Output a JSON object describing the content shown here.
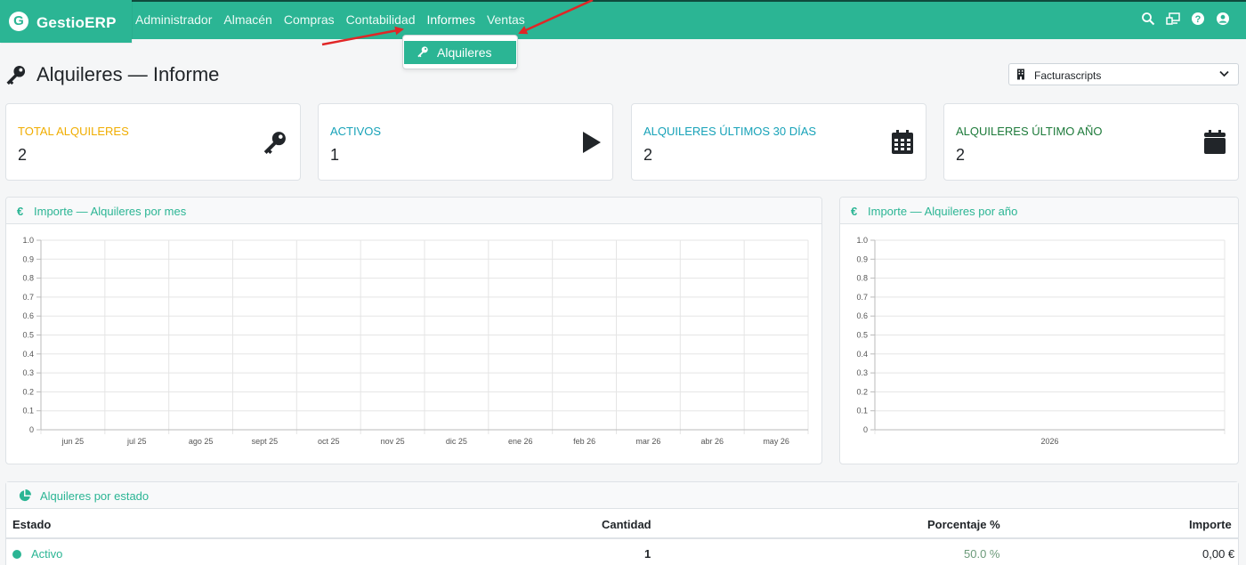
{
  "brand": {
    "logo_letter": "G",
    "name": "GestioERP"
  },
  "nav": {
    "items": [
      {
        "label": "Administrador",
        "active": false
      },
      {
        "label": "Almacén",
        "active": false
      },
      {
        "label": "Compras",
        "active": false
      },
      {
        "label": "Contabilidad",
        "active": false
      },
      {
        "label": "Informes",
        "active": true
      },
      {
        "label": "Ventas",
        "active": false
      }
    ],
    "icons": [
      "search-icon",
      "screen-share-icon",
      "help-icon",
      "user-icon"
    ]
  },
  "dropdown": {
    "item_label": "Alquileres",
    "item_icon": "key-icon"
  },
  "page": {
    "title": "Alquileres — Informe",
    "title_icon": "key-icon"
  },
  "company_select": {
    "value": "Facturascripts",
    "icon": "building-icon"
  },
  "stats": [
    {
      "label": "TOTAL ALQUILERES",
      "value": "2",
      "color": "#f0ad00",
      "icon": "key-icon"
    },
    {
      "label": "ACTIVOS",
      "value": "1",
      "color": "#17a2b8",
      "icon": "play-icon"
    },
    {
      "label": "ALQUILERES ÚLTIMOS 30 DÍAS",
      "value": "2",
      "color": "#17a2b8",
      "icon": "calendar-grid-icon"
    },
    {
      "label": "ALQUILERES ÚLTIMO AÑO",
      "value": "2",
      "color": "#1d7a3a",
      "icon": "calendar-icon"
    }
  ],
  "monthly_panel": {
    "icon": "€",
    "title": "Importe — Alquileres por mes"
  },
  "yearly_panel": {
    "icon": "€",
    "title": "Importe — Alquileres por año"
  },
  "chart_data": [
    {
      "type": "bar",
      "categories": [
        "jun 25",
        "jul 25",
        "ago 25",
        "sept 25",
        "oct 25",
        "nov 25",
        "dic 25",
        "ene 26",
        "feb 26",
        "mar 26",
        "abr 26",
        "may 26"
      ],
      "values": [
        0,
        0,
        0,
        0,
        0,
        0,
        0,
        0,
        0,
        0,
        0,
        0
      ],
      "ylim": [
        0,
        1.0
      ],
      "yticks": [
        "0",
        "0.1",
        "0.2",
        "0.3",
        "0.4",
        "0.5",
        "0.6",
        "0.7",
        "0.8",
        "0.9",
        "1.0"
      ],
      "grid": true
    },
    {
      "type": "bar",
      "categories": [
        "2026"
      ],
      "values": [
        0
      ],
      "ylim": [
        0,
        1.0
      ],
      "yticks": [
        "0",
        "0.1",
        "0.2",
        "0.3",
        "0.4",
        "0.5",
        "0.6",
        "0.7",
        "0.8",
        "0.9",
        "1.0"
      ],
      "grid": true
    }
  ],
  "status_table": {
    "icon": "pie-chart-icon",
    "title": "Alquileres por estado",
    "headers": {
      "estado": "Estado",
      "cantidad": "Cantidad",
      "porcentaje": "Porcentaje %",
      "importe": "Importe"
    },
    "rows": [
      {
        "estado": "Activo",
        "cantidad": "1",
        "porcentaje": "50.0 %",
        "importe": "0,00 €",
        "dot_color": "#2bb594"
      }
    ]
  }
}
